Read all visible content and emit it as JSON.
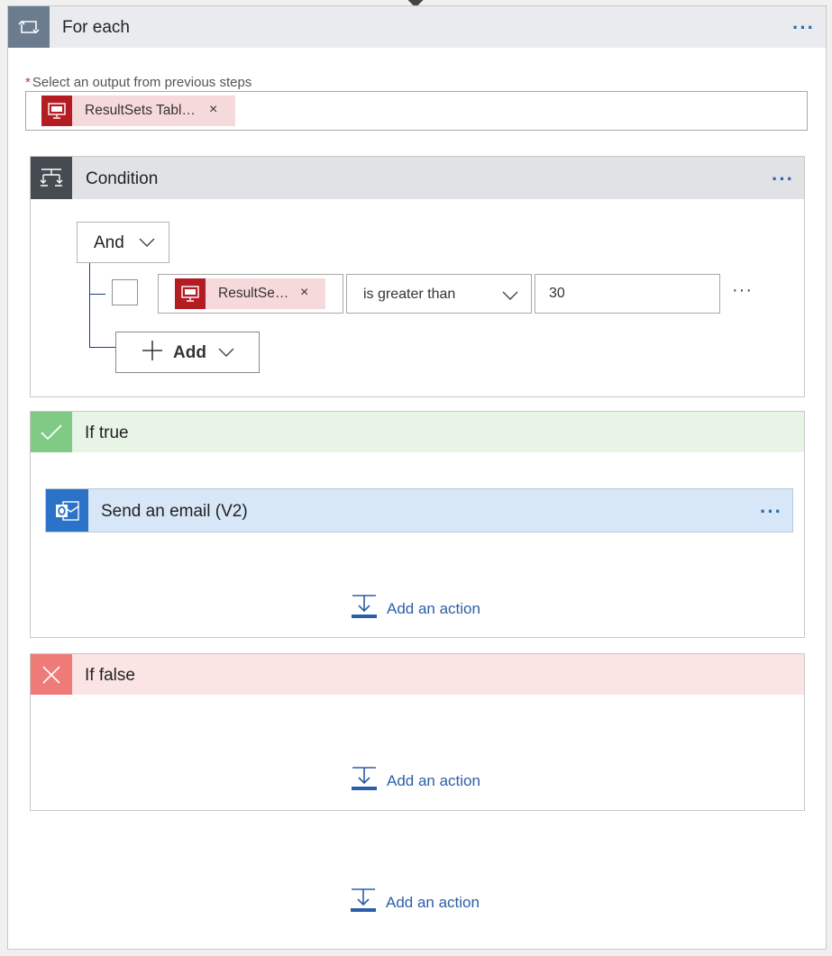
{
  "foreach": {
    "title": "For each",
    "output_label": "Select an output from previous steps",
    "output_token": "ResultSets Tabl…",
    "remove_symbol": "×",
    "more_symbol": "···"
  },
  "condition": {
    "title": "Condition",
    "group_operator": "And",
    "row": {
      "operand_token": "ResultSe…",
      "operator": "is greater than",
      "value": "30"
    },
    "add_label": "Add",
    "more_symbol": "···"
  },
  "if_true": {
    "title": "If true",
    "action_title": "Send an email (V2)",
    "add_action_label": "Add an action"
  },
  "if_false": {
    "title": "If false",
    "add_action_label": "Add an action"
  },
  "footer": {
    "add_action_label": "Add an action"
  },
  "colors": {
    "foreach_icon_bg": "#6b7c8f",
    "condition_icon_bg": "#464b52",
    "sql_token_bg": "#f6d9db",
    "sql_icon_bg": "#b41c24",
    "true_bg": "#e8f4e6",
    "true_icon": "#7fcb85",
    "false_bg": "#fbe4e4",
    "false_icon": "#ef7b78",
    "email_card_bg": "#d8e7f7",
    "outlook_icon_bg": "#2b72c9",
    "link": "#2b5fa8"
  },
  "icons": {
    "foreach": "loop-icon",
    "condition": "condition-icon",
    "sql": "sql-server-icon",
    "true": "checkmark-icon",
    "false": "close-icon",
    "outlook": "outlook-icon",
    "add_action": "add-action-icon"
  }
}
